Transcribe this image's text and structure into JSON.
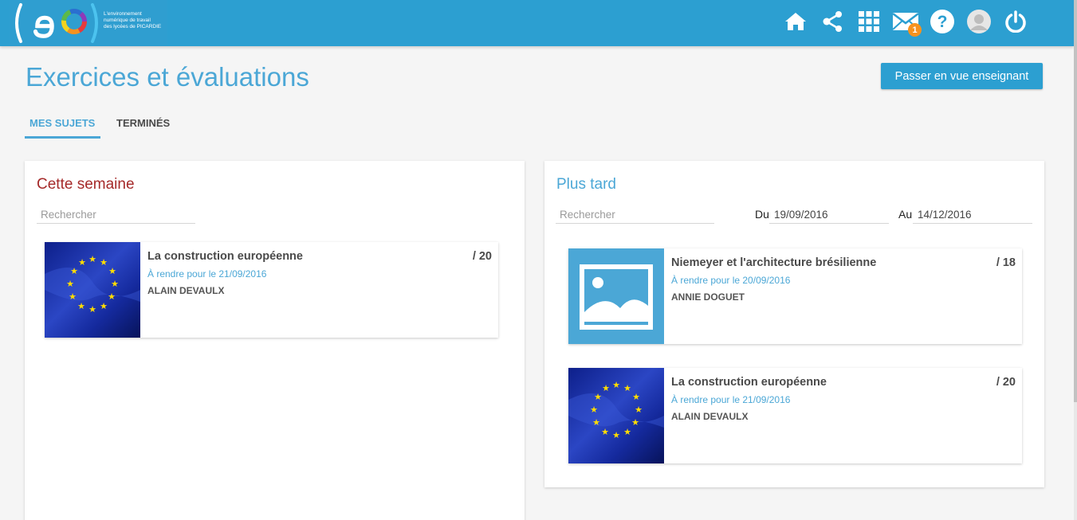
{
  "app": {
    "logo_letters": "eo",
    "logo_tagline": [
      "L'environnement",
      "numérique de travail",
      "des lycées de PICARDIE"
    ]
  },
  "nav": {
    "icons": [
      "home-icon",
      "share-icon",
      "apps-grid-icon",
      "mail-icon",
      "help-icon",
      "user-avatar-icon",
      "power-icon"
    ],
    "mail_badge": "1"
  },
  "colors": {
    "primary": "#2c9fd1",
    "title_blue": "#4ba7d6",
    "this_week_red": "#a52a2a",
    "badge_orange": "#f6921e"
  },
  "header": {
    "title": "Exercices et évaluations",
    "teacher_button": "Passer en vue enseignant"
  },
  "tabs": [
    {
      "label": "MES SUJETS",
      "active": true
    },
    {
      "label": "TERMINÉS",
      "active": false
    }
  ],
  "this_week": {
    "title": "Cette semaine",
    "search_placeholder": "Rechercher",
    "items": [
      {
        "title": "La construction européenne",
        "score": "/ 20",
        "due": "À rendre pour le 21/09/2016",
        "author": "ALAIN DEVAULX",
        "image": "eu-flag"
      }
    ]
  },
  "later": {
    "title": "Plus tard",
    "search_placeholder": "Rechercher",
    "from_label": "Du",
    "from_value": "19/09/2016",
    "to_label": "Au",
    "to_value": "14/12/2016",
    "items": [
      {
        "title": "Niemeyer et l'architecture brésilienne",
        "score": "/ 18",
        "due": "À rendre pour le 20/09/2016",
        "author": "ANNIE DOGUET",
        "image": "image-placeholder"
      },
      {
        "title": "La construction européenne",
        "score": "/ 20",
        "due": "À rendre pour le 21/09/2016",
        "author": "ALAIN DEVAULX",
        "image": "eu-flag"
      }
    ]
  }
}
